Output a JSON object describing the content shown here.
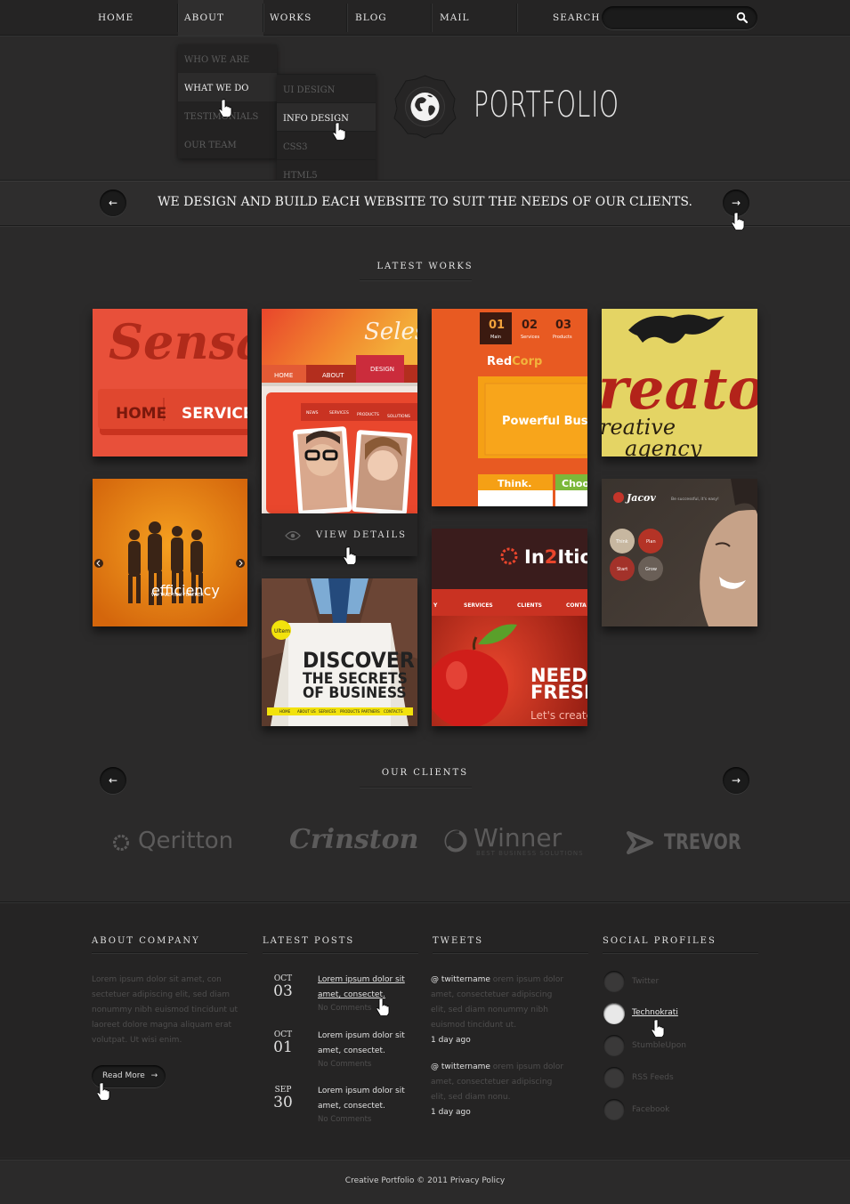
{
  "nav": {
    "items": [
      "HOME",
      "ABOUT",
      "WORKS",
      "BLOG",
      "MAIL"
    ],
    "search_label": "SEARCH",
    "search_value": ""
  },
  "about_menu": {
    "items": [
      "WHO WE ARE",
      "WHAT WE DO",
      "TESTIMONIALS",
      "OUR TEAM"
    ],
    "active": "WHAT WE DO"
  },
  "sub_menu": {
    "items": [
      "UI DESIGN",
      "INFO DESIGN",
      "CSS3",
      "HTML5"
    ],
    "active": "INFO DESIGN"
  },
  "logo": {
    "text": "PORTFOLIO",
    "icon": "globe-icon"
  },
  "slogan": "WE DESIGN AND BUILD EACH WEBSITE TO SUIT THE NEEDS OF OUR CLIENTS.",
  "latest_works": {
    "title": "LATEST WORKS",
    "view_details": "VIEW DETAILS",
    "tiles": {
      "sensa": {
        "logo": "Sensa",
        "btn1": "HOME",
        "btn2": "SERVICES"
      },
      "selesti": {
        "script": "Selesti",
        "nav1": "HOME",
        "nav2": "ABOUT",
        "nav3": "DESIGN",
        "sub1": "NEWS",
        "sub2": "SERVICES",
        "sub3": "PRODUCTS",
        "sub4": "SOLUTIONS"
      },
      "redcorp": {
        "n1": "01",
        "l1": "Main",
        "n2": "02",
        "l2": "Services",
        "n3": "03",
        "l3": "Products",
        "brand1": "Red",
        "brand2": "Corp",
        "headline": "Powerful Busin",
        "b1": "Think.",
        "b2": "Choos"
      },
      "creato": {
        "big": "reato",
        "line1": "reative",
        "line2": "agency"
      },
      "efficiency": {
        "text": "efficiency",
        "small": "WE TAKE YOU FURTHER"
      },
      "jacov": {
        "brand": "Jacov",
        "tag": "Be successful, it's easy!",
        "c1": "Think",
        "c2": "Plan",
        "c3": "Start",
        "c4": "Grow"
      },
      "discover": {
        "badge": "Ultem",
        "l1": "DISCOVER",
        "l2": "THE SECRETS",
        "l3": "OF BUSINESS",
        "nav": [
          "HOME",
          "ABOUT US",
          "SERVICES",
          "PRODUCTS",
          "PARTNERS",
          "CONTACTS"
        ]
      },
      "in2ition": {
        "brand1": "In",
        "brand2": "2",
        "brand3": "Itio",
        "n1": "Y",
        "n2": "SERVICES",
        "n3": "CLIENTS",
        "n4": "CONTA",
        "h1": "NEED",
        "h2": "FRESH",
        "sub": "Let's create"
      }
    }
  },
  "clients": {
    "title": "OUR CLIENTS",
    "items": [
      {
        "name": "Qeritton"
      },
      {
        "name": "Crinston"
      },
      {
        "name": "Winner",
        "sub": "BEST BUSINESS SOLUTIONS"
      },
      {
        "name": "TREVOR"
      }
    ]
  },
  "footer": {
    "about": {
      "title": "ABOUT COMPANY",
      "text": "Lorem ipsum dolor sit amet, con sectetuer adipiscing elit, sed diam nonummy nibh euismod tincidunt ut laoreet dolore magna aliquam erat volutpat. Ut wisi enim.",
      "read_more": "Read More"
    },
    "posts": {
      "title": "LATEST POSTS",
      "items": [
        {
          "month": "OCT",
          "day": "03",
          "title": "Lorem ipsum dolor sit amet, consectet.",
          "meta": "No Comments"
        },
        {
          "month": "OCT",
          "day": "01",
          "title": "Lorem ipsum dolor sit amet, consectet.",
          "meta": "No Comments"
        },
        {
          "month": "SEP",
          "day": "30",
          "title": "Lorem ipsum dolor sit amet, consectet.",
          "meta": "No Comments"
        }
      ]
    },
    "tweets": {
      "title": "TWEETS",
      "items": [
        {
          "handle": "@ twittername",
          "text": "orem ipsum dolor amet, consectetuer adipiscing elit, sed diam nonummy nibh euismod tincidunt ut.",
          "ago": "1 day ago"
        },
        {
          "handle": "@ twittername",
          "text": "orem ipsum dolor amet, consectetuer adipiscing elit, sed diam nonu.",
          "ago": "1 day ago"
        }
      ]
    },
    "social": {
      "title": "SOCIAL PROFILES",
      "items": [
        {
          "label": "Twitter",
          "icon": "twitter-icon"
        },
        {
          "label": "Technokrati",
          "icon": "technorati-icon"
        },
        {
          "label": "StumbleUpon",
          "icon": "stumbleupon-icon"
        },
        {
          "label": "RSS Feeds",
          "icon": "rss-icon"
        },
        {
          "label": "Facebook",
          "icon": "facebook-icon"
        }
      ]
    },
    "copyright": "Creative Portfolio © 2011 Privacy Policy"
  },
  "colors": {
    "bg": "#2b2a2a",
    "accent": "#e8452c",
    "dark": "#252424"
  }
}
